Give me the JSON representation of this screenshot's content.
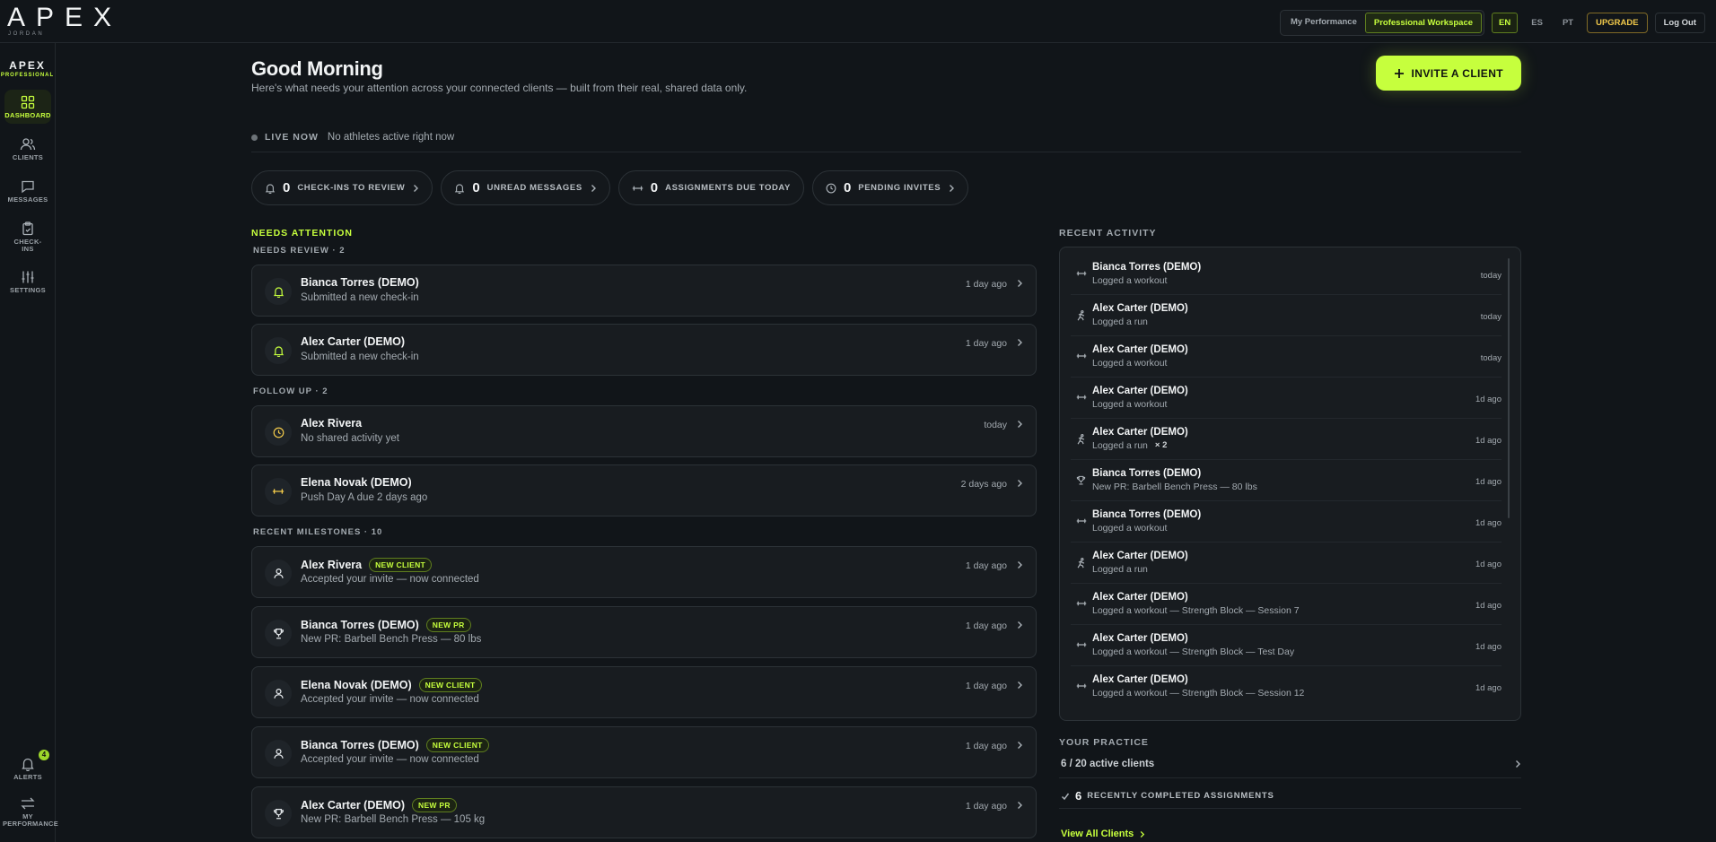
{
  "topbar": {
    "logo": "APEX",
    "user": "JORDAN",
    "mode_tabs": [
      "My Performance",
      "Professional Workspace"
    ],
    "active_mode": "Professional Workspace",
    "languages": [
      "EN",
      "ES",
      "PT"
    ],
    "active_language": "EN",
    "upgrade_label": "UPGRADE",
    "logout_label": "Log Out"
  },
  "sidebar": {
    "brand": "APEX",
    "brand_sub": "PROFESSIONAL",
    "items": [
      {
        "label": "DASHBOARD",
        "icon": "grid-icon",
        "active": true
      },
      {
        "label": "CLIENTS",
        "icon": "users-icon"
      },
      {
        "label": "MESSAGES",
        "icon": "message-icon"
      },
      {
        "label": "CHECK-INS",
        "icon": "clipboard-icon"
      },
      {
        "label": "SETTINGS",
        "icon": "sliders-icon"
      }
    ],
    "bottom": [
      {
        "label": "ALERTS",
        "icon": "bell-icon",
        "badge": "4"
      },
      {
        "label": "MY PERFORMANCE",
        "icon": "switch-icon"
      }
    ]
  },
  "header": {
    "greeting": "Good Morning",
    "intro": "Here's what needs your attention across your connected clients — built from their real, shared data only.",
    "invite_label": "INVITE A CLIENT",
    "live_label": "LIVE NOW",
    "live_text": "No athletes active right now"
  },
  "stats": [
    {
      "value": "0",
      "label": "CHECK-INS TO REVIEW",
      "icon": "bell-icon"
    },
    {
      "value": "0",
      "label": "UNREAD MESSAGES",
      "icon": "bell-icon"
    },
    {
      "value": "0",
      "label": "ASSIGNMENTS DUE TODAY",
      "icon": "dumbbell-icon"
    },
    {
      "value": "0",
      "label": "PENDING INVITES",
      "icon": "clock-icon"
    }
  ],
  "needs_attention": {
    "title": "NEEDS ATTENTION",
    "review_head": "NEEDS REVIEW · 2",
    "review": [
      {
        "name": "Bianca Torres (DEMO)",
        "desc": "Submitted a new check-in",
        "when": "1 day ago",
        "icon": "bell-icon"
      },
      {
        "name": "Alex Carter (DEMO)",
        "desc": "Submitted a new check-in",
        "when": "1 day ago",
        "icon": "bell-icon"
      }
    ],
    "follow_head": "FOLLOW UP · 2",
    "follow": [
      {
        "name": "Alex Rivera",
        "desc": "No shared activity yet",
        "when": "today",
        "icon": "clock-icon"
      },
      {
        "name": "Elena Novak (DEMO)",
        "desc": "Push Day A due 2 days ago",
        "when": "2 days ago",
        "icon": "dumbbell-icon"
      }
    ],
    "milestones_head": "RECENT MILESTONES · 10",
    "milestones": [
      {
        "name": "Alex Rivera",
        "badge": "NEW CLIENT",
        "desc": "Accepted your invite — now connected",
        "when": "1 day ago",
        "icon": "user-icon"
      },
      {
        "name": "Bianca Torres (DEMO)",
        "badge": "NEW PR",
        "desc": "New PR: Barbell Bench Press — 80 lbs",
        "when": "1 day ago",
        "icon": "trophy-icon"
      },
      {
        "name": "Elena Novak (DEMO)",
        "badge": "NEW CLIENT",
        "desc": "Accepted your invite — now connected",
        "when": "1 day ago",
        "icon": "user-icon"
      },
      {
        "name": "Bianca Torres (DEMO)",
        "badge": "NEW CLIENT",
        "desc": "Accepted your invite — now connected",
        "when": "1 day ago",
        "icon": "user-icon"
      },
      {
        "name": "Alex Carter (DEMO)",
        "badge": "NEW PR",
        "desc": "New PR: Barbell Bench Press — 105 kg",
        "when": "1 day ago",
        "icon": "trophy-icon"
      }
    ]
  },
  "recent_activity": {
    "title": "RECENT ACTIVITY",
    "items": [
      {
        "name": "Bianca Torres (DEMO)",
        "desc": "Logged a workout",
        "time": "today",
        "icon": "dumbbell-icon"
      },
      {
        "name": "Alex Carter (DEMO)",
        "desc": "Logged a run",
        "time": "today",
        "icon": "run-icon"
      },
      {
        "name": "Alex Carter (DEMO)",
        "desc": "Logged a workout",
        "time": "today",
        "icon": "dumbbell-icon"
      },
      {
        "name": "Alex Carter (DEMO)",
        "desc": "Logged a workout",
        "time": "1d ago",
        "icon": "dumbbell-icon"
      },
      {
        "name": "Alex Carter (DEMO)",
        "desc": "Logged a run",
        "count": "× 2",
        "time": "1d ago",
        "icon": "run-icon"
      },
      {
        "name": "Bianca Torres (DEMO)",
        "desc": "New PR: Barbell Bench Press — 80 lbs",
        "time": "1d ago",
        "icon": "trophy-icon"
      },
      {
        "name": "Bianca Torres (DEMO)",
        "desc": "Logged a workout",
        "time": "1d ago",
        "icon": "dumbbell-icon"
      },
      {
        "name": "Alex Carter (DEMO)",
        "desc": "Logged a run",
        "time": "1d ago",
        "icon": "run-icon"
      },
      {
        "name": "Alex Carter (DEMO)",
        "desc": "Logged a workout — Strength Block — Session 7",
        "time": "1d ago",
        "icon": "dumbbell-icon"
      },
      {
        "name": "Alex Carter (DEMO)",
        "desc": "Logged a workout — Strength Block — Test Day",
        "time": "1d ago",
        "icon": "dumbbell-icon"
      },
      {
        "name": "Alex Carter (DEMO)",
        "desc": "Logged a workout — Strength Block — Session 12",
        "time": "1d ago",
        "icon": "dumbbell-icon"
      }
    ]
  },
  "practice": {
    "title": "YOUR PRACTICE",
    "active_clients": "6 / 20 active clients",
    "completed_count": "6",
    "completed_label": "RECENTLY COMPLETED ASSIGNMENTS",
    "view_all": "View All Clients"
  },
  "colors": {
    "accent": "#c6ff3d",
    "background": "#111519",
    "card": "#181c20",
    "upgrade": "#f1c94a"
  }
}
